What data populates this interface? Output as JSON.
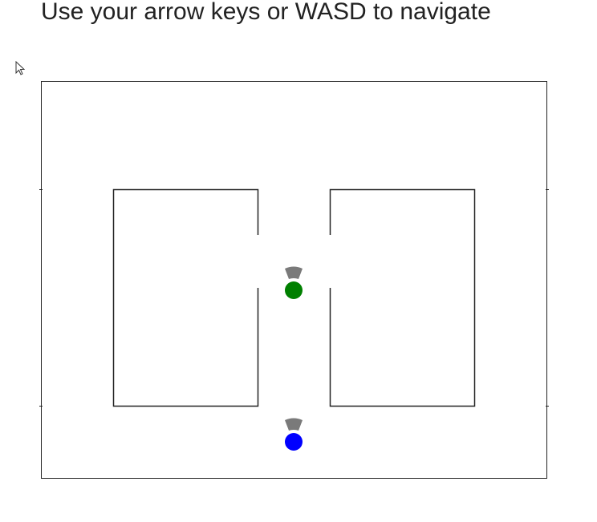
{
  "instructions": "Use your arrow keys or WASD to navigate",
  "icons": {
    "cursor": "mouse-pointer-icon",
    "sensor": "sensor-cone-icon"
  },
  "agents": [
    {
      "name": "green-agent",
      "color": "#008000",
      "heading": "up"
    },
    {
      "name": "blue-agent",
      "color": "#0000ff",
      "heading": "up"
    }
  ],
  "colors": {
    "wall": "#222222",
    "background": "#ffffff",
    "sensor": "#7a7a7a"
  }
}
